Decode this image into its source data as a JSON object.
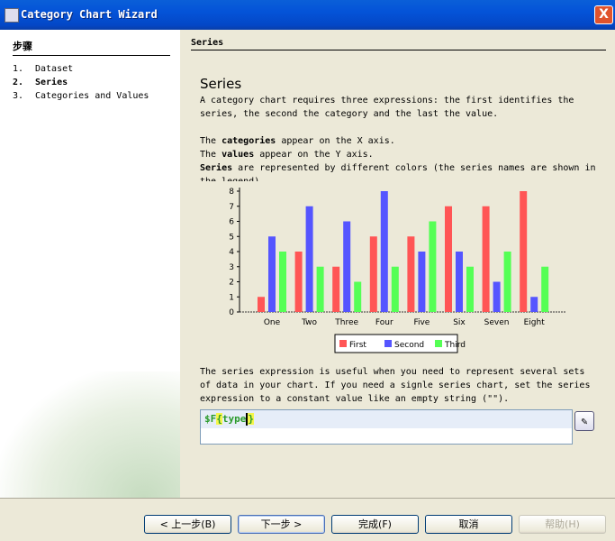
{
  "window": {
    "title": "Category Chart Wizard",
    "close_label": "X"
  },
  "steps": {
    "heading": "步骤",
    "items": [
      {
        "num": "1.",
        "label": "Dataset"
      },
      {
        "num": "2.",
        "label": "Series",
        "active": true
      },
      {
        "num": "3.",
        "label": "Categories and Values"
      }
    ]
  },
  "panel": {
    "header": "Series",
    "title": "Series",
    "intro": "A category chart requires three expressions: the first identifies the series, the second the category and the last the value.",
    "cat_pre": "The ",
    "cat_bold": "categories",
    "cat_post": " appear on the X axis.",
    "val_pre": "The ",
    "val_bold": "values",
    "val_post": " appear on the Y axis.",
    "ser_bold": "Series",
    "ser_post": " are represented by different colors (the series names are shown in the legend).",
    "desc": "The series expression is useful when you need to represent several sets of data in your chart. If you need a signle series chart, set the series expression to a constant value like an empty string (\"\").",
    "expr_prefix": "$F",
    "expr_open": "{",
    "expr_name": "type",
    "expr_close": "}"
  },
  "chart_data": {
    "type": "bar",
    "categories": [
      "One",
      "Two",
      "Three",
      "Four",
      "Five",
      "Six",
      "Seven",
      "Eight"
    ],
    "series": [
      {
        "name": "First",
        "color": "#ff5555",
        "values": [
          1,
          4,
          3,
          5,
          5,
          7,
          7,
          8
        ]
      },
      {
        "name": "Second",
        "color": "#5555ff",
        "values": [
          5,
          7,
          6,
          8,
          4,
          4,
          2,
          1
        ]
      },
      {
        "name": "Third",
        "color": "#55ff55",
        "values": [
          4,
          3,
          2,
          3,
          6,
          3,
          4,
          3
        ]
      }
    ],
    "ylim": [
      0,
      8
    ],
    "yticks": [
      "0",
      "1",
      "2",
      "3",
      "4",
      "5",
      "6",
      "7",
      "8"
    ],
    "legend": "bottom",
    "grid": false
  },
  "buttons": {
    "back": "< 上一步(B)",
    "next": "下一步 >",
    "finish": "完成(F)",
    "cancel": "取消",
    "help": "帮助(H)"
  }
}
